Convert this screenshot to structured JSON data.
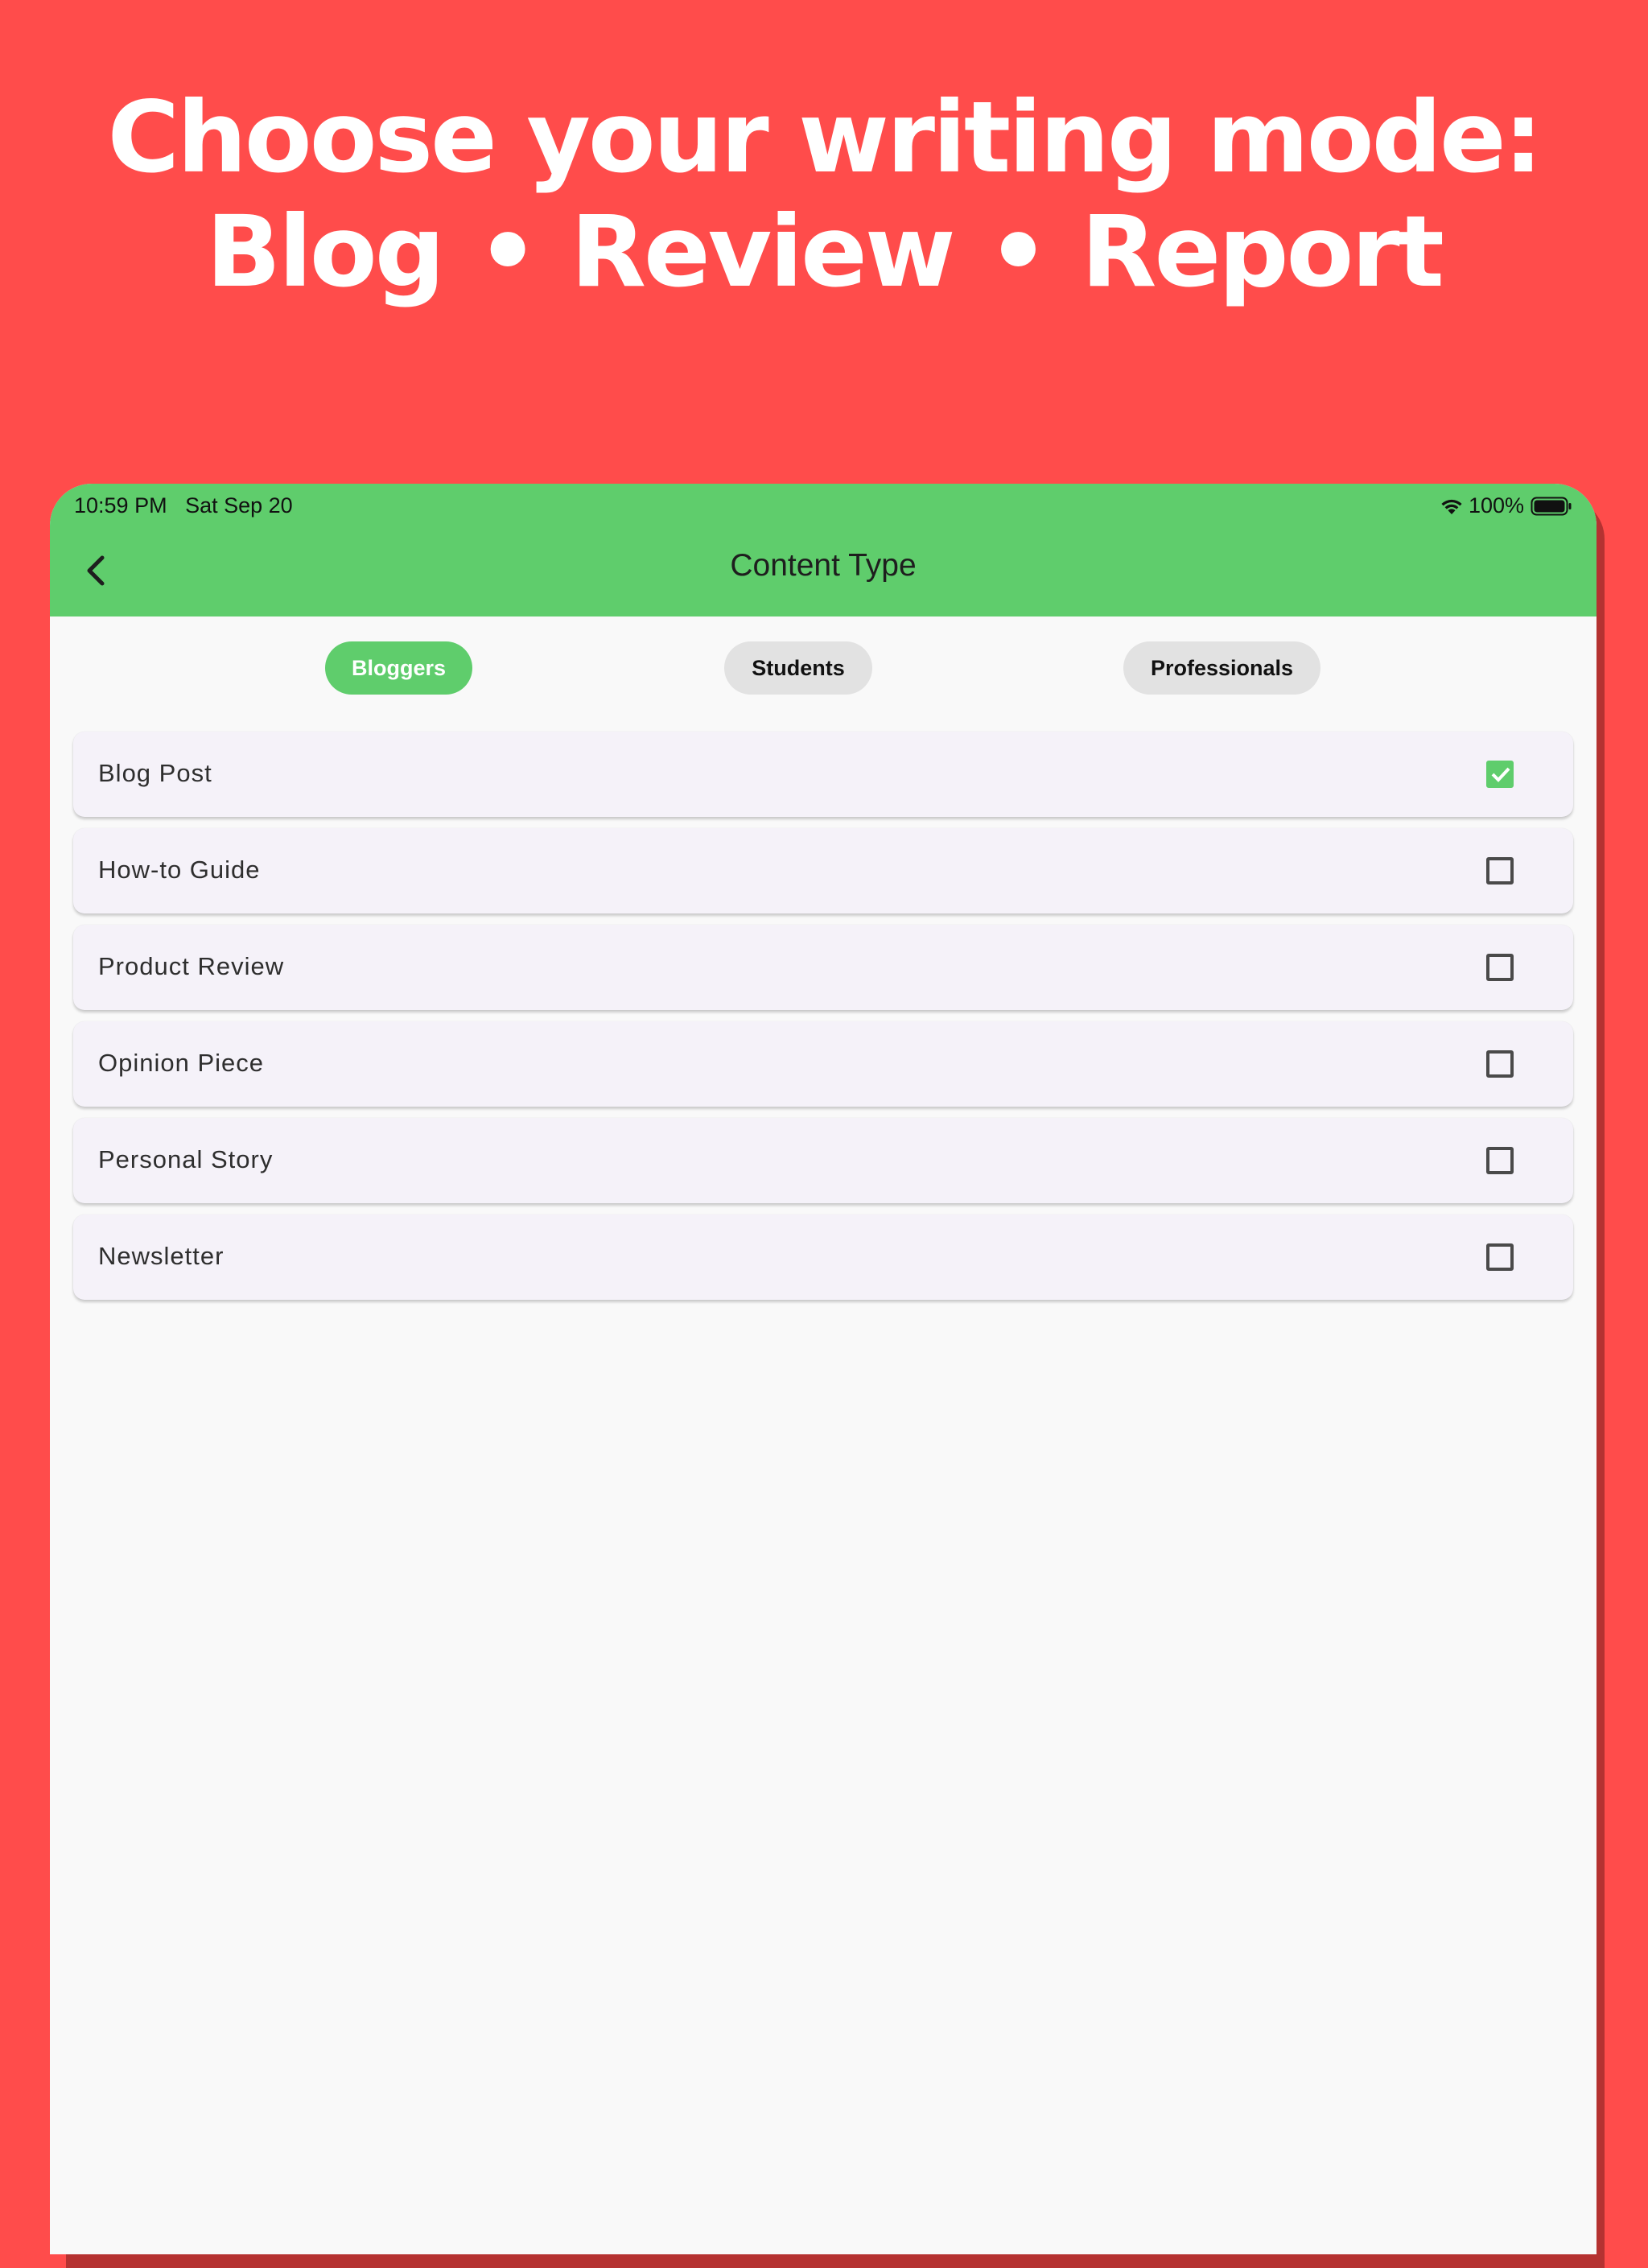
{
  "headline": {
    "line1": "Choose your writing mode:",
    "word1": "Blog",
    "sep": "•",
    "word2": "Review",
    "word3": "Report"
  },
  "status_bar": {
    "time": "10:59 PM",
    "date": "Sat Sep 20",
    "battery": "100%"
  },
  "app_bar": {
    "title": "Content Type"
  },
  "segments": [
    {
      "label": "Bloggers",
      "selected": true
    },
    {
      "label": "Students",
      "selected": false
    },
    {
      "label": "Professionals",
      "selected": false
    }
  ],
  "items": [
    {
      "label": "Blog Post",
      "checked": true
    },
    {
      "label": "How-to Guide",
      "checked": false
    },
    {
      "label": "Product Review",
      "checked": false
    },
    {
      "label": "Opinion Piece",
      "checked": false
    },
    {
      "label": "Personal Story",
      "checked": false
    },
    {
      "label": "Newsletter",
      "checked": false
    }
  ],
  "colors": {
    "background": "#FF4C4B",
    "accent": "#5FCD6C",
    "content_bg": "#F9F9F9",
    "row_bg": "#F5F2F9",
    "chip_bg": "#E2E2E2"
  }
}
